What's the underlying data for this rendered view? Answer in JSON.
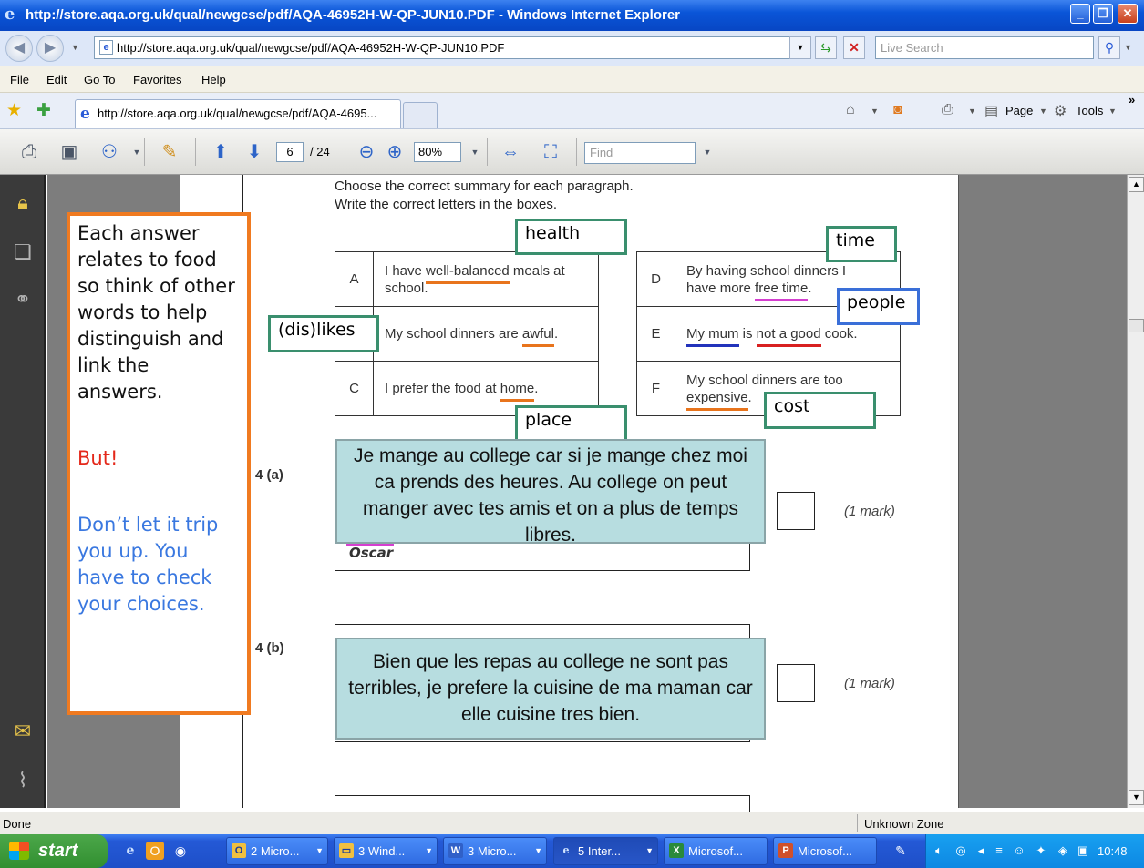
{
  "window": {
    "title": "http://store.aqa.org.uk/qual/newgcse/pdf/AQA-46952H-W-QP-JUN10.PDF - Windows Internet Explorer",
    "minimize": "_",
    "maximize": "❐",
    "close": "✕"
  },
  "address": {
    "url": "http://store.aqa.org.uk/qual/newgcse/pdf/AQA-46952H-W-QP-JUN10.PDF",
    "search_placeholder": "Live Search"
  },
  "menu": [
    "File",
    "Edit",
    "Go To",
    "Favorites",
    "Help"
  ],
  "tab": {
    "label": "http://store.aqa.org.uk/qual/newgcse/pdf/AQA-4695..."
  },
  "commands": {
    "page": "Page",
    "tools": "Tools",
    "more": "»"
  },
  "pdf_toolbar": {
    "page_current": "6",
    "page_total": "/ 24",
    "zoom": "80%",
    "find_placeholder": "Find"
  },
  "document": {
    "instruction_1": "Choose the correct summary for each paragraph.",
    "instruction_2": "Write the correct letters in the boxes.",
    "left_table": [
      {
        "letter": "A",
        "pre": "I have ",
        "underline": "well-balanced",
        "post": " meals at school.",
        "line2": "school."
      },
      {
        "letter": "B",
        "pre": "My school dinners are ",
        "underline": "awful",
        "post": "."
      },
      {
        "letter": "C",
        "pre": "I prefer the food at ",
        "underline": "home",
        "post": "."
      }
    ],
    "right_table": [
      {
        "letter": "D",
        "line1": "By having school dinners I",
        "line2_pre": "have more ",
        "underline": "free time",
        "post": "."
      },
      {
        "letter": "E",
        "u1": "My mum",
        "mid": " is ",
        "u2": "not a good",
        "post": " cook."
      },
      {
        "letter": "F",
        "line1": "My school dinners are too",
        "underline": "expensive",
        "post": "."
      }
    ],
    "q4a_label": "4  (a)",
    "q4b_label": "4  (b)",
    "mark_a": "(1 mark)",
    "mark_b": "(1 mark)",
    "name_a": "Oscar"
  },
  "annotations": {
    "health": "health",
    "time": "time",
    "people": "people",
    "dislikes": "(dis)likes",
    "place": "place",
    "cost": "cost",
    "para_a": "Je mange au college car si je mange chez moi ca prends des heures. Au college on peut manger avec  tes amis et on a plus de temps libres.",
    "para_b": "Bien que les repas au college ne sont pas terribles, je prefere la cuisine de ma maman car elle cuisine tres bien."
  },
  "tip": {
    "main": "Each answer relates to food so think of other words to help distinguish and link the answers.",
    "but": "But!",
    "warn": "Don’t let it trip you up. You have to check your choices."
  },
  "status": {
    "left": "Done",
    "zone": "Unknown Zone"
  },
  "taskbar": {
    "start": "start",
    "tasks": [
      "2 Micro...",
      "3 Wind...",
      "3 Micro...",
      "5 Inter...",
      "Microsof...",
      "Microsof..."
    ],
    "clock": "10:48"
  },
  "colors": {
    "orange_underline": "#e8741c",
    "green_box": "#3a8f6e",
    "blue_box": "#3a6fd8",
    "para_bg": "#b7dde0"
  }
}
